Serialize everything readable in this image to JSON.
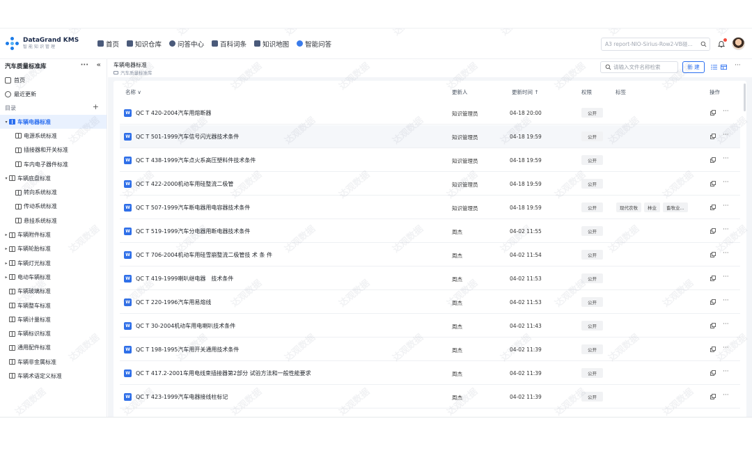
{
  "app": {
    "logo_title": "DataGrand KMS",
    "logo_subtitle": "智能知识管理",
    "brand_color": "#1d7ce8",
    "accent_color": "#2b6ff0"
  },
  "nav": {
    "items": [
      {
        "label": "首页",
        "icon": "home-icon"
      },
      {
        "label": "知识仓库",
        "icon": "repository-icon"
      },
      {
        "label": "问答中心",
        "icon": "chat-icon"
      },
      {
        "label": "百科词条",
        "icon": "encyclopedia-icon"
      },
      {
        "label": "知识地图",
        "icon": "map-icon"
      },
      {
        "label": "智能问答",
        "icon": "ai-qa-icon"
      }
    ],
    "search_value": "A3 report-NIO-Sirius-Row2-VB碰...",
    "notification_icon": "bell-icon",
    "notification_badge_color": "#f24a3b"
  },
  "sidebar": {
    "title": "汽车质量标准库",
    "more": "···",
    "collapse": "«",
    "links": [
      {
        "label": "首页",
        "icon": "home-icon"
      },
      {
        "label": "最近更新",
        "icon": "clock-icon"
      }
    ],
    "section_label": "目录",
    "add": "+",
    "tree": [
      {
        "label": "车辆电器标准",
        "level": 0,
        "arrow": "▾",
        "active": true
      },
      {
        "label": "电源系统标准",
        "level": 1,
        "arrow": "",
        "active": false
      },
      {
        "label": "插接器和开关标准",
        "level": 1,
        "arrow": "",
        "active": false
      },
      {
        "label": "车内电子器件标准",
        "level": 1,
        "arrow": "",
        "active": false
      },
      {
        "label": "车辆底盘标准",
        "level": 0,
        "arrow": "▾",
        "active": false
      },
      {
        "label": "转向系统标准",
        "level": 1,
        "arrow": "",
        "active": false
      },
      {
        "label": "传动系统标准",
        "level": 1,
        "arrow": "",
        "active": false
      },
      {
        "label": "悬挂系统标准",
        "level": 1,
        "arrow": "",
        "active": false
      },
      {
        "label": "车辆附件标准",
        "level": 0,
        "arrow": "▸",
        "active": false
      },
      {
        "label": "车辆轮胎标准",
        "level": 0,
        "arrow": "▸",
        "active": false
      },
      {
        "label": "车辆灯光标准",
        "level": 0,
        "arrow": "▸",
        "active": false
      },
      {
        "label": "电动车辆标准",
        "level": 0,
        "arrow": "▸",
        "active": false
      },
      {
        "label": "车辆玻璃标准",
        "level": 0,
        "arrow": "",
        "active": false
      },
      {
        "label": "车辆整车标准",
        "level": 0,
        "arrow": "",
        "active": false
      },
      {
        "label": "车辆计量标准",
        "level": 0,
        "arrow": "",
        "active": false
      },
      {
        "label": "车辆标识标准",
        "level": 0,
        "arrow": "",
        "active": false
      },
      {
        "label": "通用配件标准",
        "level": 0,
        "arrow": "",
        "active": false
      },
      {
        "label": "车辆非金属标准",
        "level": 0,
        "arrow": "",
        "active": false
      },
      {
        "label": "车辆术语定义标准",
        "level": 0,
        "arrow": "",
        "active": false
      }
    ]
  },
  "main": {
    "title": "车辆电器标准",
    "breadcrumb": "汽车质量标准库",
    "search_placeholder": "请输入文件名称检索",
    "new_button": "新 建",
    "more": "···",
    "columns": {
      "name": "名称 ∨",
      "updater": "更新人",
      "updated": "更新时间 ↑",
      "permission": "权限",
      "tags": "标签",
      "actions": "操作"
    },
    "file_icon_letter": "W",
    "rows": [
      {
        "name": "QC T 420-2004汽车用熔断器",
        "updater": "知识管理员",
        "time": "04-18 20:00",
        "perm": "公开",
        "tags": []
      },
      {
        "name": "QC T 501-1999汽车信号闪光器技术条件",
        "updater": "知识管理员",
        "time": "04-18 19:59",
        "perm": "公开",
        "tags": []
      },
      {
        "name": "QC T 438-1999汽车点火系高压塑料件技术条件",
        "updater": "知识管理员",
        "time": "04-18 19:59",
        "perm": "公开",
        "tags": []
      },
      {
        "name": "QC T 422-2000机动车用硅整流二极管",
        "updater": "知识管理员",
        "time": "04-18 19:59",
        "perm": "公开",
        "tags": []
      },
      {
        "name": "QC T 507-1999汽车断电器用电容器技术条件",
        "updater": "知识管理员",
        "time": "04-18 19:59",
        "perm": "公开",
        "tags": [
          "现代农牧",
          "林业",
          "畜牧业..."
        ]
      },
      {
        "name": "QC T 519-1999汽车分电器用断电器技术条件",
        "updater": "周杰",
        "time": "04-02 11:55",
        "perm": "公开",
        "tags": []
      },
      {
        "name": "QC T 706-2004机动车用硅雪崩整流二极管技 术 条 件",
        "updater": "周杰",
        "time": "04-02 11:54",
        "perm": "公开",
        "tags": []
      },
      {
        "name": "QC T 419-1999喇叭继电器　技术条件",
        "updater": "周杰",
        "time": "04-02 11:53",
        "perm": "公开",
        "tags": []
      },
      {
        "name": "QC T 220-1996汽车用易熔线",
        "updater": "周杰",
        "time": "04-02 11:53",
        "perm": "公开",
        "tags": []
      },
      {
        "name": "QC T 30-2004机动车用电喇叭技术条件",
        "updater": "周杰",
        "time": "04-02 11:43",
        "perm": "公开",
        "tags": []
      },
      {
        "name": "QC T 198-1995汽车用开关通用技术条件",
        "updater": "周杰",
        "time": "04-02 11:39",
        "perm": "公开",
        "tags": []
      },
      {
        "name": "QC T 417.2-2001车用电线束插接器第2部分 试验方法和一般性能要求",
        "updater": "周杰",
        "time": "04-02 11:39",
        "perm": "公开",
        "tags": []
      },
      {
        "name": "QC T 423-1999汽车电器接线柱标记",
        "updater": "周杰",
        "time": "04-02 11:39",
        "perm": "公开",
        "tags": []
      }
    ]
  },
  "watermark": {
    "text": "达观数据",
    "sub": "DATA GRAND"
  }
}
